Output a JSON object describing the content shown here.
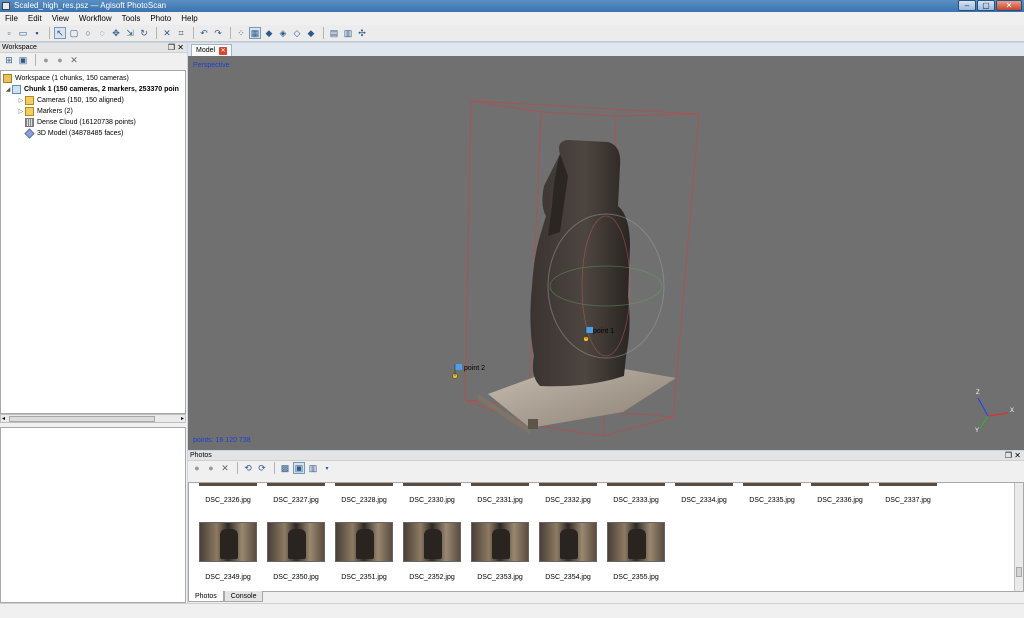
{
  "window": {
    "title": "Scaled_high_res.psz — Agisoft PhotoScan"
  },
  "menu": [
    "File",
    "Edit",
    "View",
    "Workflow",
    "Tools",
    "Photo",
    "Help"
  ],
  "workspace": {
    "title": "Workspace",
    "tree": [
      {
        "label": "Workspace (1 chunks, 150 cameras)",
        "icon": "workspace-icon",
        "level": 0
      },
      {
        "label": "Chunk 1 (150 cameras, 2 markers, 253370 poin",
        "icon": "chunk-icon",
        "level": 1,
        "bold": true
      },
      {
        "label": "Cameras (150, 150 aligned)",
        "icon": "folder-icon",
        "level": 2
      },
      {
        "label": "Markers (2)",
        "icon": "folder-icon",
        "level": 2
      },
      {
        "label": "Dense Cloud (16120738 points)",
        "icon": "dense-cloud-icon",
        "level": 2
      },
      {
        "label": "3D Model (34878485 faces)",
        "icon": "model-icon",
        "level": 2
      }
    ]
  },
  "model_view": {
    "tab_label": "Model",
    "projection": "Perspective",
    "points_readout": "points: 16 120 738",
    "markers": [
      "point 1",
      "point 2"
    ],
    "axes": [
      "X",
      "Y",
      "Z"
    ]
  },
  "photos": {
    "title": "Photos",
    "row1": [
      "DSC_2326.jpg",
      "DSC_2327.jpg",
      "DSC_2328.jpg",
      "DSC_2330.jpg",
      "DSC_2331.jpg",
      "DSC_2332.jpg",
      "DSC_2333.jpg",
      "DSC_2334.jpg",
      "DSC_2335.jpg",
      "DSC_2336.jpg",
      "DSC_2337.jpg"
    ],
    "row2": [
      "DSC_2349.jpg",
      "DSC_2350.jpg",
      "DSC_2351.jpg",
      "DSC_2352.jpg",
      "DSC_2353.jpg",
      "DSC_2354.jpg",
      "DSC_2355.jpg"
    ],
    "tabs": [
      "Photos",
      "Console"
    ]
  },
  "colors": {
    "viewport": "#707070",
    "label_blue": "#1a3fd6",
    "bbox": "#d04848"
  }
}
